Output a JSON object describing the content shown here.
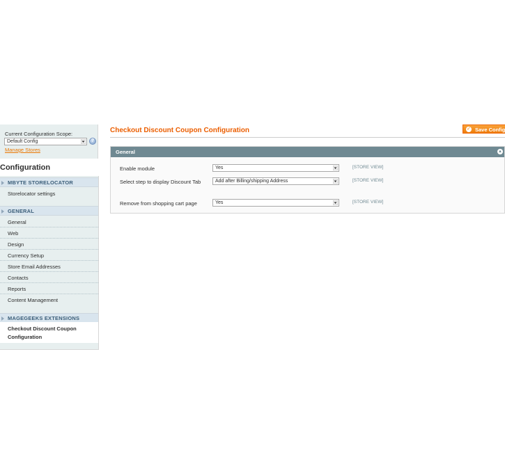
{
  "scope": {
    "label": "Current Configuration Scope:",
    "selected": "Default Config",
    "manage_link": "Manage Stores"
  },
  "sidebar": {
    "title": "Configuration",
    "groups": [
      {
        "name": "MBYTE STORELOCATOR",
        "items": [
          "Storelocator settings"
        ]
      },
      {
        "name": "GENERAL",
        "items": [
          "General",
          "Web",
          "Design",
          "Currency Setup",
          "Store Email Addresses",
          "Contacts",
          "Reports",
          "Content Management"
        ]
      },
      {
        "name": "MAGEGEEKS EXTENSIONS",
        "items": [
          "Checkout Discount Coupon Configuration"
        ]
      }
    ]
  },
  "header": {
    "title": "Checkout Discount Coupon Configuration",
    "save_label": "Save Config"
  },
  "section": {
    "title": "General",
    "rows": [
      {
        "label": "Enable module",
        "value": "Yes",
        "scope": "[STORE VIEW]"
      },
      {
        "label": "Select step to display Discount Tab",
        "value": "Add after Billing/shipping Address",
        "scope": "[STORE VIEW]"
      },
      {
        "label": "Remove from shopping cart page",
        "value": "Yes",
        "scope": "[STORE VIEW]"
      }
    ]
  },
  "colors": {
    "accent_orange": "#eb5e00",
    "section_header": "#6f8992",
    "sidebar_bg": "#e7efef"
  },
  "icons": [
    "chevron-down-icon",
    "help-icon",
    "checkmark-icon",
    "collapse-icon",
    "triangle-right-icon"
  ]
}
